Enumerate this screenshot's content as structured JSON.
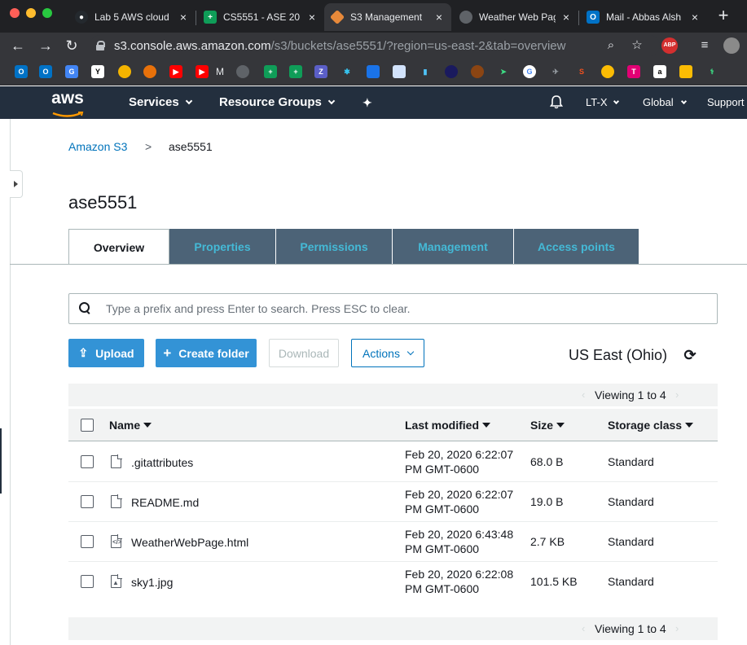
{
  "browser": {
    "tabs": [
      {
        "title": "Lab 5 AWS cloud",
        "favicon": "github-icon",
        "active": false
      },
      {
        "title": "CS5551 - ASE 20",
        "favicon": "sheets-icon",
        "active": false
      },
      {
        "title": "S3 Management",
        "favicon": "aws-s3-icon",
        "active": true
      },
      {
        "title": "Weather Web Pag",
        "favicon": "globe-icon",
        "active": false
      },
      {
        "title": "Mail - Abbas Alsh",
        "favicon": "outlook-icon",
        "active": false
      }
    ],
    "url_host": "s3.console.aws.amazon.com",
    "url_path": "/s3/buckets/ase5551/?region=us-east-2&tab=overview",
    "bookmark_text": "M",
    "abp_label": "ABP"
  },
  "aws_nav": {
    "logo_text": "aws",
    "services": "Services",
    "resource_groups": "Resource Groups",
    "account": "LT-X",
    "region": "Global",
    "support": "Support"
  },
  "breadcrumb": {
    "root": "Amazon S3",
    "separator": ">",
    "current": "ase5551"
  },
  "bucket": {
    "name": "ase5551"
  },
  "tabs": [
    {
      "label": "Overview",
      "active": true
    },
    {
      "label": "Properties",
      "active": false
    },
    {
      "label": "Permissions",
      "active": false
    },
    {
      "label": "Management",
      "active": false
    },
    {
      "label": "Access points",
      "active": false
    }
  ],
  "search": {
    "placeholder": "Type a prefix and press Enter to search. Press ESC to clear.",
    "value": ""
  },
  "actions": {
    "upload": "Upload",
    "create_folder": "Create folder",
    "download": "Download",
    "actions": "Actions"
  },
  "region_label": "US East (Ohio)",
  "pagination": {
    "top": "Viewing 1 to 4",
    "bottom": "Viewing 1 to 4"
  },
  "table": {
    "headers": {
      "name": "Name",
      "last_modified": "Last modified",
      "size": "Size",
      "storage_class": "Storage class"
    },
    "rows": [
      {
        "name": ".gitattributes",
        "icon": "file-icon",
        "modified_line1": "Feb 20, 2020 6:22:07",
        "modified_line2": "PM GMT-0600",
        "size": "68.0 B",
        "storage_class": "Standard"
      },
      {
        "name": "README.md",
        "icon": "file-icon",
        "modified_line1": "Feb 20, 2020 6:22:07",
        "modified_line2": "PM GMT-0600",
        "size": "19.0 B",
        "storage_class": "Standard"
      },
      {
        "name": "WeatherWebPage.html",
        "icon": "code-file-icon",
        "modified_line1": "Feb 20, 2020 6:43:48",
        "modified_line2": "PM GMT-0600",
        "size": "2.7 KB",
        "storage_class": "Standard"
      },
      {
        "name": "sky1.jpg",
        "icon": "image-file-icon",
        "modified_line1": "Feb 20, 2020 6:22:08",
        "modified_line2": "PM GMT-0600",
        "size": "101.5 KB",
        "storage_class": "Standard"
      }
    ]
  },
  "colors": {
    "aws_nav_bg": "#232f3e",
    "link": "#0073bb",
    "primary_button": "#3393d6",
    "inactive_tab": "#4c6377",
    "inactive_tab_text": "#44b9d6"
  }
}
